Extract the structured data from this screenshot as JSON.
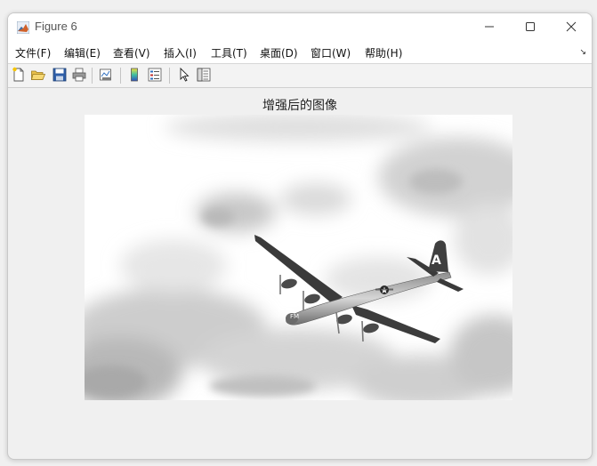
{
  "window": {
    "title": "Figure 6"
  },
  "menu": {
    "items": [
      "文件(F)",
      "编辑(E)",
      "查看(V)",
      "插入(I)",
      "工具(T)",
      "桌面(D)",
      "窗口(W)",
      "帮助(H)"
    ]
  },
  "toolbar": {
    "icons": [
      "new-figure-icon",
      "open-file-icon",
      "save-icon",
      "print-icon",
      "link-plot-icon",
      "insert-colorbar-icon",
      "insert-legend-icon",
      "edit-plot-arrow-icon",
      "property-inspector-icon"
    ]
  },
  "axes": {
    "title": "增强后的图像"
  },
  "image": {
    "subject": "grayscale-airplane-in-clouds",
    "tail_letter": "A",
    "nose_text": "FM"
  },
  "colors": {
    "titlebar_bg": "#ffffff",
    "window_bg": "#f0f0f0",
    "plane": "#3a3a3a"
  }
}
